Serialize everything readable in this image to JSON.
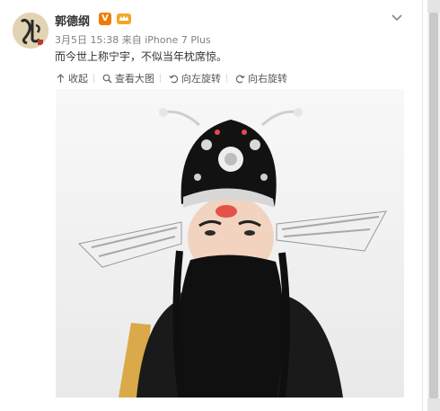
{
  "post": {
    "username": "郭德纲",
    "verified_badge": "V",
    "date": "3月5日 15:38",
    "source_prefix": "来自",
    "source_device": "iPhone 7 Plus",
    "text": "而今世上称宁宇，不似当年枕席惊。"
  },
  "toolbar": {
    "collapse_label": "收起",
    "view_large_label": "查看大图",
    "rotate_left_label": "向左旋转",
    "rotate_right_label": "向右旋转"
  },
  "icons": {
    "avatar": "avatar-calligraphy",
    "verify": "verified-v-icon",
    "member": "crown-icon",
    "more": "chevron-down-icon",
    "collapse": "arrow-up-icon",
    "view_large": "magnifier-icon",
    "rotate_left": "rotate-left-icon",
    "rotate_right": "rotate-right-icon"
  },
  "colors": {
    "accent_orange": "#f07b00",
    "text_gray": "#808080"
  }
}
